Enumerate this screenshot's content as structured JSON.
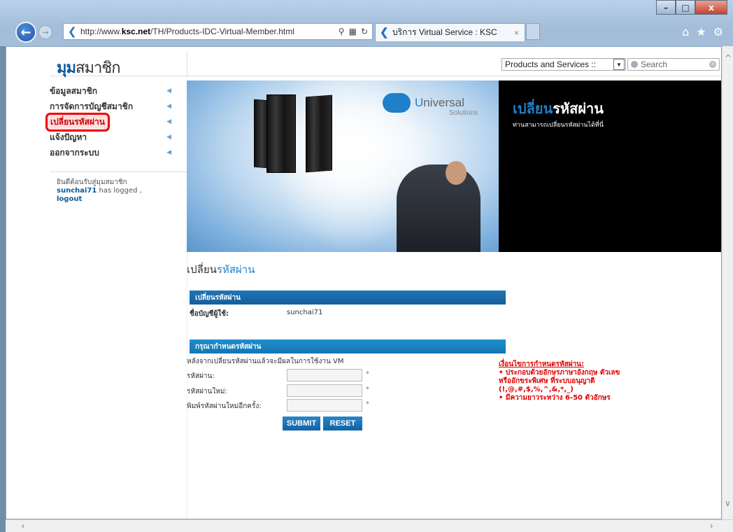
{
  "browser": {
    "url_prefix": "http://www.",
    "url_domain": "ksc.net",
    "url_path": "/TH/Products-IDC-Virtual-Member.html",
    "tab_title": "บริการ Virtual Service : KSC",
    "window_buttons": {
      "minimize": "–",
      "maximize": "□",
      "close": "x"
    },
    "icons": [
      "back-arrow-icon",
      "forward-arrow-icon",
      "search-icon",
      "refresh-icon",
      "home-icon",
      "star-icon",
      "gear-icon"
    ]
  },
  "header": {
    "logo_part1": "มุม",
    "logo_part2": "สมาชิก",
    "products_select": "Products and Services ::",
    "search_placeholder": "Search"
  },
  "sidebar": {
    "items": [
      {
        "label": "ข้อมูลสมาชิก"
      },
      {
        "label": "การจัดการบัญชีสมาชิก"
      },
      {
        "label": "เปลี่ยนรหัสผ่าน"
      },
      {
        "label": "แจ้งปัญหา"
      },
      {
        "label": "ออกจากระบบ"
      }
    ],
    "welcome": "ยินดีต้อนรับสู่มุมสมาชิก",
    "username": "sunchai71",
    "logged_text": " has logged ,",
    "logout": "logout"
  },
  "banner": {
    "brand_first": "U",
    "brand_rest": "niversal",
    "brand_sub": "Solutions",
    "title_part1": "เปลี่ยน",
    "title_part2": "รหัสผ่าน",
    "subtitle": "ท่านสามารถเปลี่ยนรหัสผ่านได้ที่นี่"
  },
  "section": {
    "title_part1": "เปลี่ยน",
    "title_part2": "รหัสผ่าน"
  },
  "account_box": {
    "header": "เปลี่ยนรหัสผ่าน",
    "account_label": "ชื่อบัญชีผู้ใช้:",
    "account_value": "sunchai71"
  },
  "password_box": {
    "header": "กรุณากำหนดรหัสผ่าน",
    "note": "หลังจากเปลี่ยนรหัสผ่านแล้วจะมีผลในการใช้งาน VM",
    "fields": [
      {
        "label": "รหัสผ่าน:",
        "value": ""
      },
      {
        "label": "รหัสผ่านใหม่:",
        "value": ""
      },
      {
        "label": "พิมพ์รหัสผ่านใหม่อีกครั้ง:",
        "value": ""
      }
    ],
    "required_mark": "*",
    "submit": "SUBMIT",
    "reset": "RESET"
  },
  "rules": {
    "title": "เงื่อนไขการกำหนดรหัสผ่าน:",
    "line1": "• ประกอบด้วยอักษรภาษาอังกฤษ ตัวเลข",
    "line2": "หรืออักขระพิเศษ ที่ระบบอนุญาติ",
    "line3": "(!,@,#,$,%,^,&,*,_)",
    "line4": "• มีความยาวระหว่าง 6-50 ตัวอักษร"
  },
  "colors": {
    "accent_blue": "#1f7fc8",
    "active_highlight": "#e00000",
    "rules_red": "#e00000"
  }
}
